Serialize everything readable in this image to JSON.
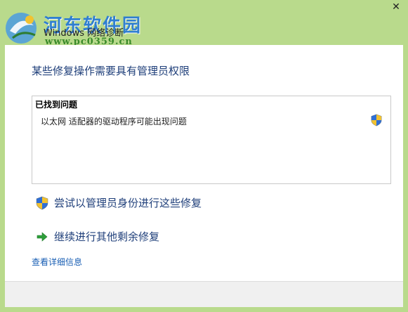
{
  "window": {
    "title": "Windows 网络诊断",
    "close_glyph": "✕"
  },
  "watermark": {
    "site_name": "河东软件园",
    "site_url": "www.pc0359.cn"
  },
  "content": {
    "headline": "某些修复操作需要具有管理员权限",
    "problem_box": {
      "header": "已找到问题",
      "items": [
        {
          "label": "以太网 适配器的驱动程序可能出现问题",
          "icon": "uac-shield-icon"
        }
      ]
    },
    "actions": [
      {
        "label": "尝试以管理员身份进行这些修复",
        "icon": "uac-shield-icon"
      },
      {
        "label": "继续进行其他剩余修复",
        "icon": "green-arrow-icon"
      }
    ],
    "details_link": "查看详细信息"
  },
  "colors": {
    "title_bg": "#b9da8c",
    "heading_text": "#1f3f7a",
    "link_text": "#1a5fb4"
  }
}
